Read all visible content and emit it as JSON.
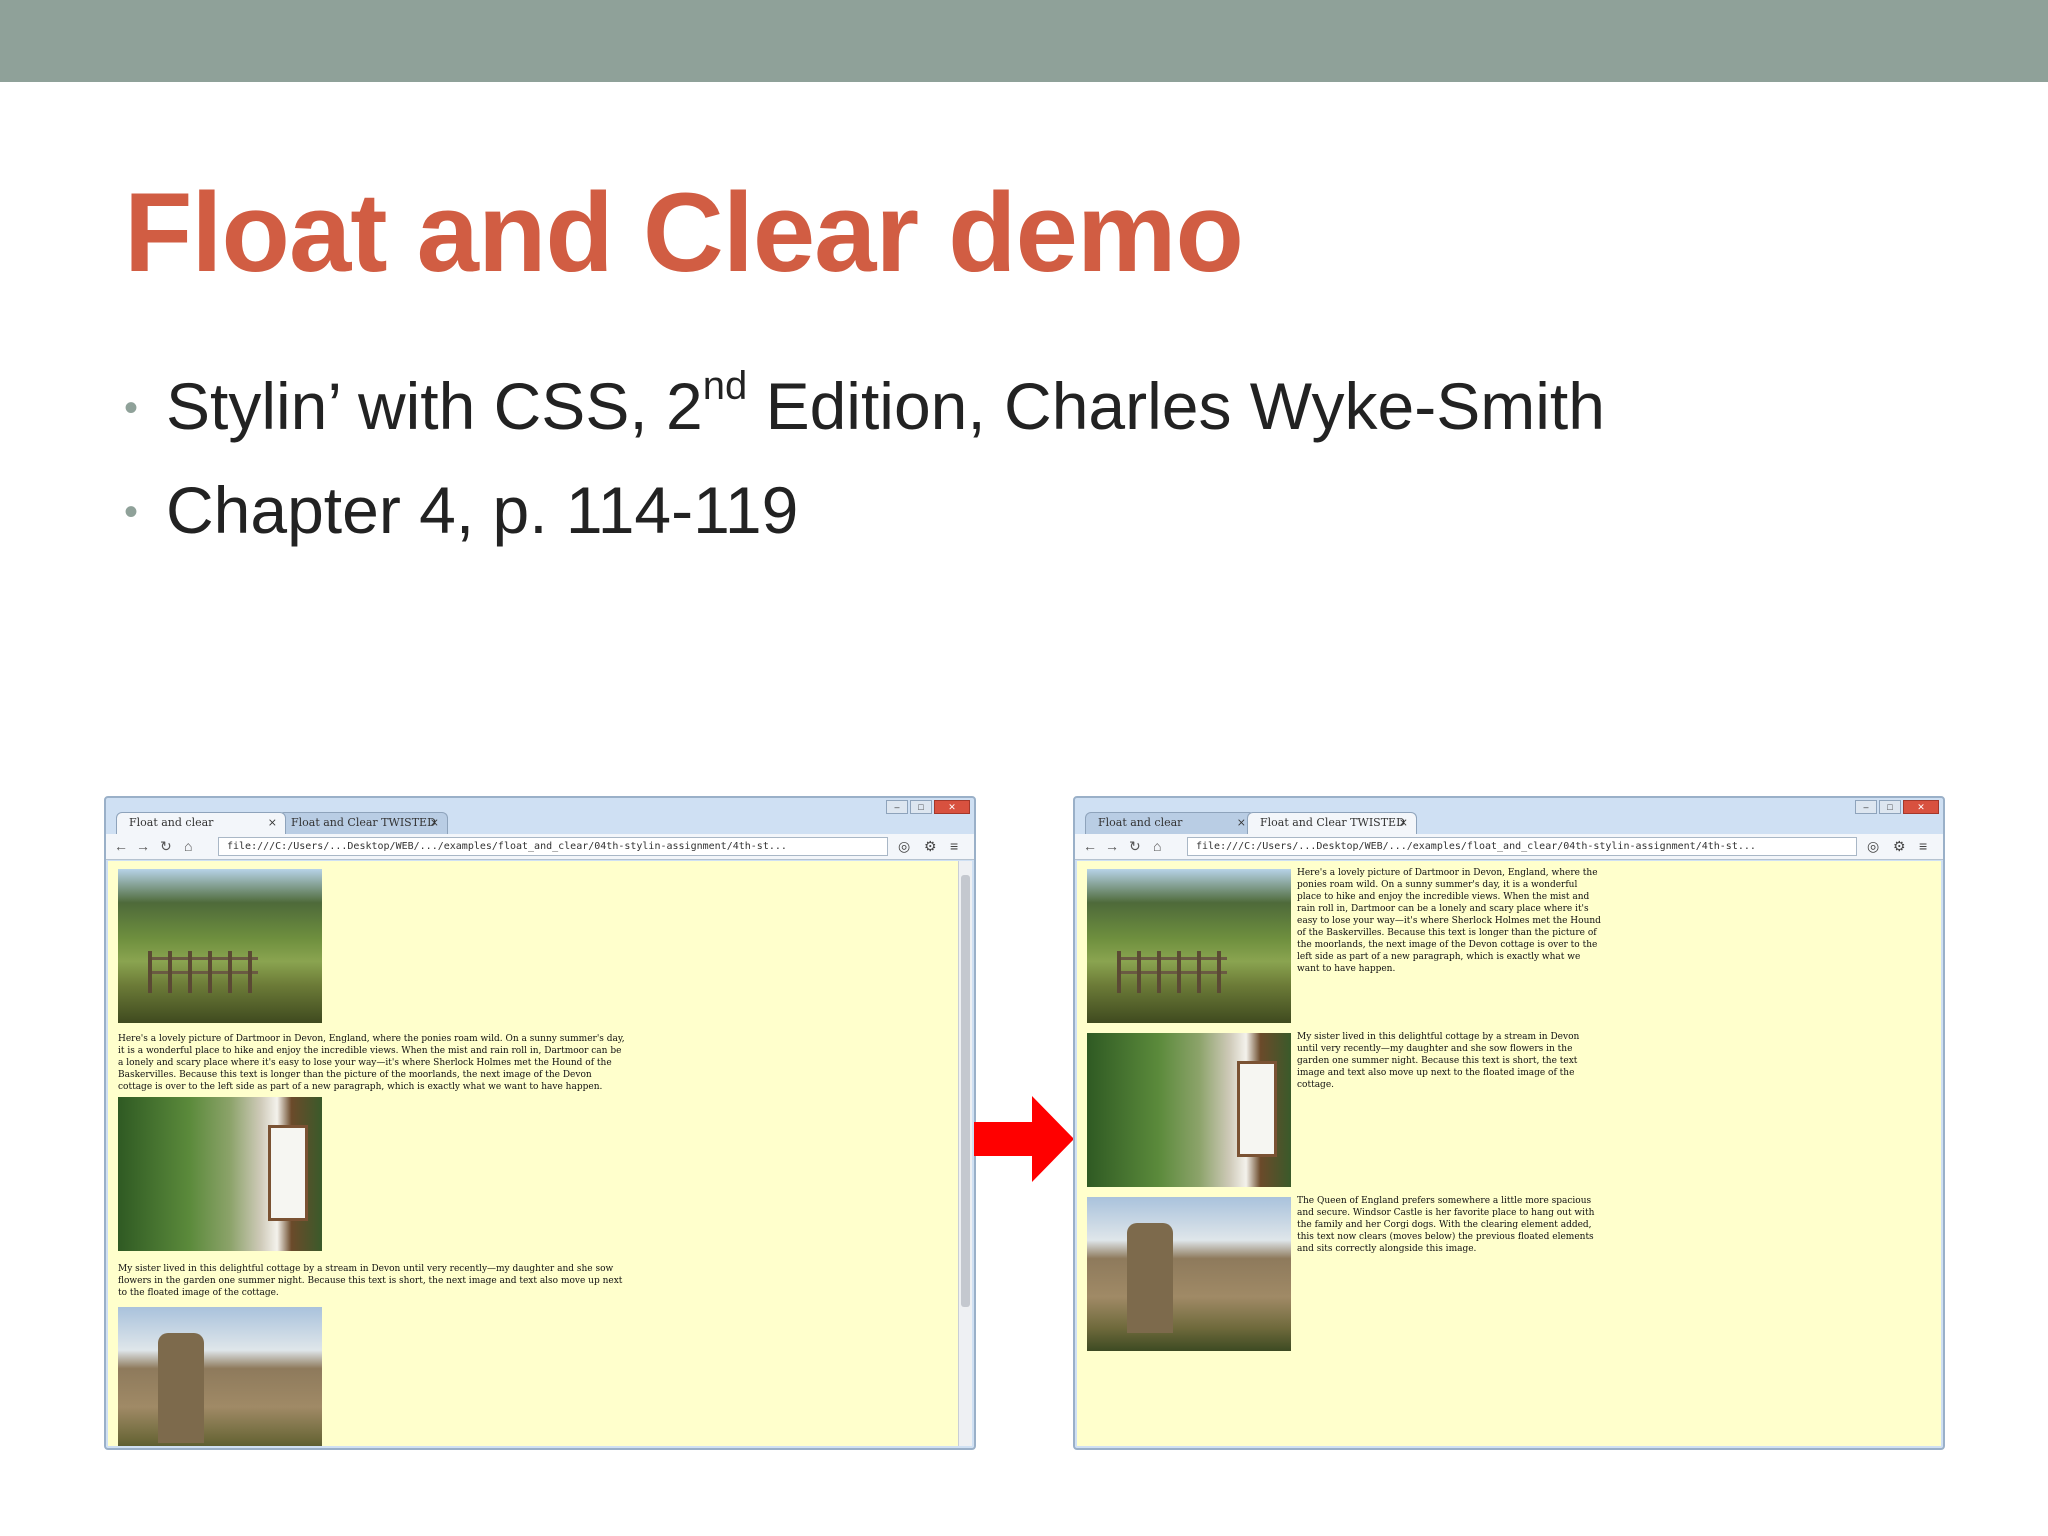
{
  "slide": {
    "title": "Float and Clear demo",
    "bullets": [
      {
        "pre": "Stylin’ with CSS, 2",
        "sup": "nd",
        "post": " Edition, Charles Wyke-Smith"
      },
      {
        "pre": "Chapter 4, p. 114-119",
        "sup": "",
        "post": ""
      }
    ],
    "colors": {
      "band": "#8fa199",
      "title": "#d15d43",
      "arrow": "#ff0000",
      "page_bg": "#ffffcc"
    }
  },
  "browser_left": {
    "tabs": [
      "Float and clear",
      "Float and Clear TWISTED"
    ],
    "url": "file:///C:/Users/...Desktop/WEB/.../examples/float_and_clear/04th-stylin-assignment/4th-st...",
    "paragraphs": [
      "Here's a lovely picture of Dartmoor in Devon, England, where the ponies roam wild. On a sunny summer's day, it is a wonderful place to hike and enjoy the incredible views. When the mist and rain roll in, Dartmoor can be a lonely and scary place where it's easy to lose your way—it's where Sherlock Holmes met the Hound of the Baskervilles. Because this text is longer than the picture of the moorlands, the next image of the Devon cottage is over to the left side as part of a new paragraph, which is exactly what we want to have happen.",
      "My sister lived in this delightful cottage by a stream in Devon until very recently—my daughter and she sow flowers in the garden one summer night. Because this text is short, the next image and text also move up next to the floated image of the cottage."
    ]
  },
  "browser_right": {
    "tabs": [
      "Float and clear",
      "Float and Clear TWISTED"
    ],
    "url": "file:///C:/Users/...Desktop/WEB/.../examples/float_and_clear/04th-stylin-assignment/4th-st...",
    "paragraphs": [
      "Here's a lovely picture of Dartmoor in Devon, England, where the ponies roam wild. On a sunny summer's day, it is a wonderful place to hike and enjoy the incredible views. When the mist and rain roll in, Dartmoor can be a lonely and scary place where it's easy to lose your way—it's where Sherlock Holmes met the Hound of the Baskervilles. Because this text is longer than the picture of the moorlands, the next image of the Devon cottage is over to the left side as part of a new paragraph, which is exactly what we want to have happen.",
      "My sister lived in this delightful cottage by a stream in Devon until very recently—my daughter and she sow flowers in the garden one summer night. Because this text is short, the text image and text also move up next to the floated image of the cottage.",
      "The Queen of England prefers somewhere a little more spacious and secure. Windsor Castle is her favorite place to hang out with the family and her Corgi dogs. With the clearing element added, this text now clears (moves below) the previous floated elements and sits correctly alongside this image."
    ]
  }
}
